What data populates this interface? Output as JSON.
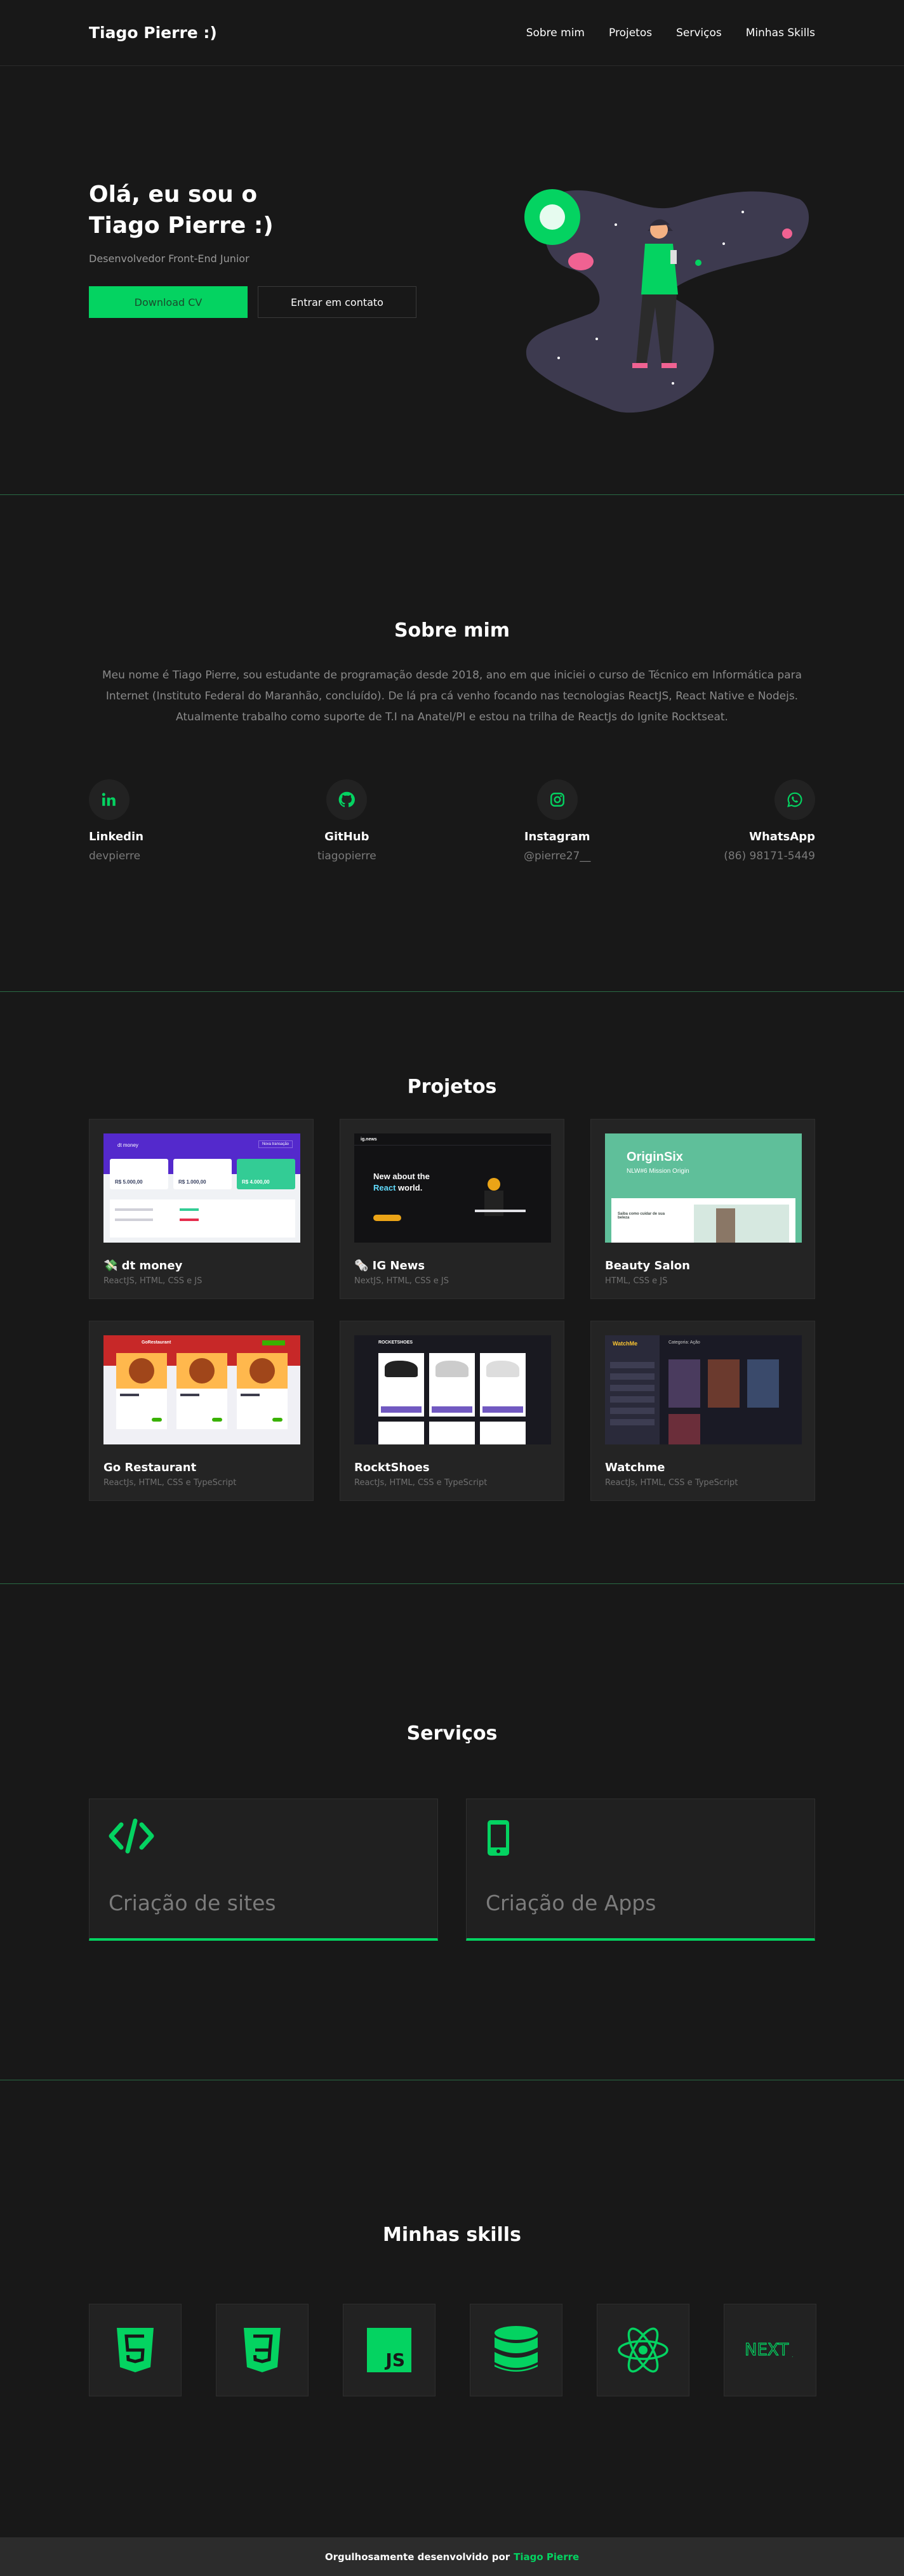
{
  "header": {
    "logo": "Tiago Pierre :)",
    "nav": [
      "Sobre mim",
      "Projetos",
      "Serviços",
      "Minhas Skills"
    ]
  },
  "hero": {
    "title_line1": "Olá, eu sou o",
    "title_line2": "Tiago Pierre :)",
    "subtitle": "Desenvolvedor Front-End Junior",
    "download_label": "Download CV",
    "contact_label": "Entrar em contato"
  },
  "about": {
    "title": "Sobre mim",
    "text": "Meu nome é Tiago Pierre, sou estudante de programação desde 2018, ano em que iniciei o curso de Técnico em Informática para Internet (Instituto Federal do Maranhão, concluído). De lá pra cá venho focando nas tecnologias ReactJS, React Native e Nodejs. Atualmente trabalho como suporte de T.I na Anatel/PI e estou na trilha de ReactJs do Ignite Rocktseat.",
    "contacts": [
      {
        "name": "Linkedin",
        "value": "devpierre",
        "icon": "linkedin-icon"
      },
      {
        "name": "GitHub",
        "value": "tiagopierre",
        "icon": "github-icon"
      },
      {
        "name": "Instagram",
        "value": "@pierre27__",
        "icon": "instagram-icon"
      },
      {
        "name": "WhatsApp",
        "value": "(86) 98171-5449",
        "icon": "whatsapp-icon"
      }
    ]
  },
  "projects": {
    "title": "Projetos",
    "items": [
      {
        "name": "💸 dt money",
        "tech": "ReactJS, HTML, CSS e JS"
      },
      {
        "name": "🗞️ IG News",
        "tech": "NextJS, HTML, CSS e JS"
      },
      {
        "name": "Beauty Salon",
        "tech": "HTML, CSS e JS"
      },
      {
        "name": "Go Restaurant",
        "tech": "ReactJs, HTML, CSS e TypeScript"
      },
      {
        "name": "RocktShoes",
        "tech": "ReactJs, HTML, CSS e TypeScript"
      },
      {
        "name": "Watchme",
        "tech": "ReactJs, HTML, CSS e TypeScript"
      }
    ],
    "thumbs": {
      "dtmoney": {
        "brand": "dt money",
        "btn": "Nova transação",
        "card1": "R$ 5.000,00",
        "card2": "R$ 1.000,00",
        "card3": "R$ 4.000,00"
      },
      "ignews": {
        "brand": "ig.news",
        "line1": "New about the",
        "line2a": "React",
        "line2b": " world."
      },
      "beauty": {
        "title": "OriginSix",
        "subtitle": "NLW#6 Mission Origin",
        "caption": "Saiba como cuidar de sua beleza"
      },
      "go": {
        "brand": "GoRestaurant"
      },
      "shoes": {
        "brand": "ROCKETSHOES"
      },
      "watchme": {
        "brand": "WatchMe",
        "category": "Categoria: Ação"
      }
    }
  },
  "services": {
    "title": "Serviços",
    "items": [
      {
        "label": "Criação de sites",
        "icon": "code-icon"
      },
      {
        "label": "Criação de Apps",
        "icon": "mobile-icon"
      }
    ]
  },
  "skills": {
    "title": "Minhas skills",
    "items": [
      "html5-icon",
      "css3-icon",
      "javascript-icon",
      "database-icon",
      "react-icon",
      "nextjs-icon"
    ],
    "next_label": "NEXT",
    "js_label": "JS"
  },
  "footer": {
    "text": "Orgulhosamente desenvolvido por",
    "author": "Tiago Pierre"
  },
  "colors": {
    "accent": "#04d361",
    "background": "#181818"
  }
}
